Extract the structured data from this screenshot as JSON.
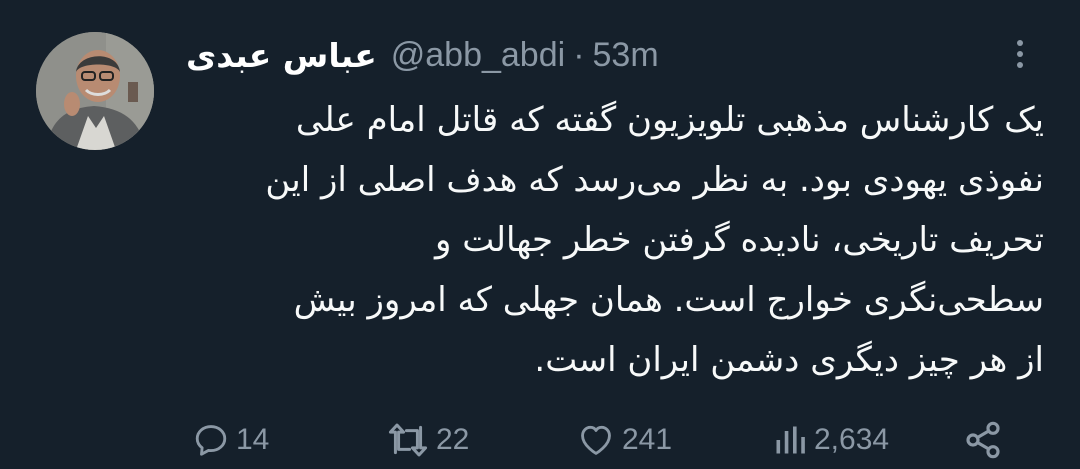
{
  "author": {
    "display_name": "عباس عبدی",
    "handle": "@abb_abdi",
    "separator": "·",
    "time_ago": "53m"
  },
  "tweet": {
    "lines": [
      "یک کارشناس مذهبی تلویزیون گفته که قاتل امام علی",
      "نفوذی یهودی بود. به نظر می‌رسد که هدف اصلی از این",
      "تحریف تاریخی، نادیده گرفتن خطر جهالت و",
      "سطحی‌نگری خوارج است. همان جهلی که امروز بیش",
      "از هر چیز دیگری دشمن ایران است."
    ]
  },
  "actions": {
    "replies": "14",
    "retweets": "22",
    "likes": "241",
    "views": "2,634"
  },
  "icons": {
    "more": "more-vertical-icon",
    "reply": "reply-icon",
    "retweet": "retweet-icon",
    "like": "heart-icon",
    "views": "views-icon",
    "share": "share-icon"
  },
  "colors": {
    "background": "#15202b",
    "text": "#f7f9f9",
    "muted": "#8b98a5"
  }
}
